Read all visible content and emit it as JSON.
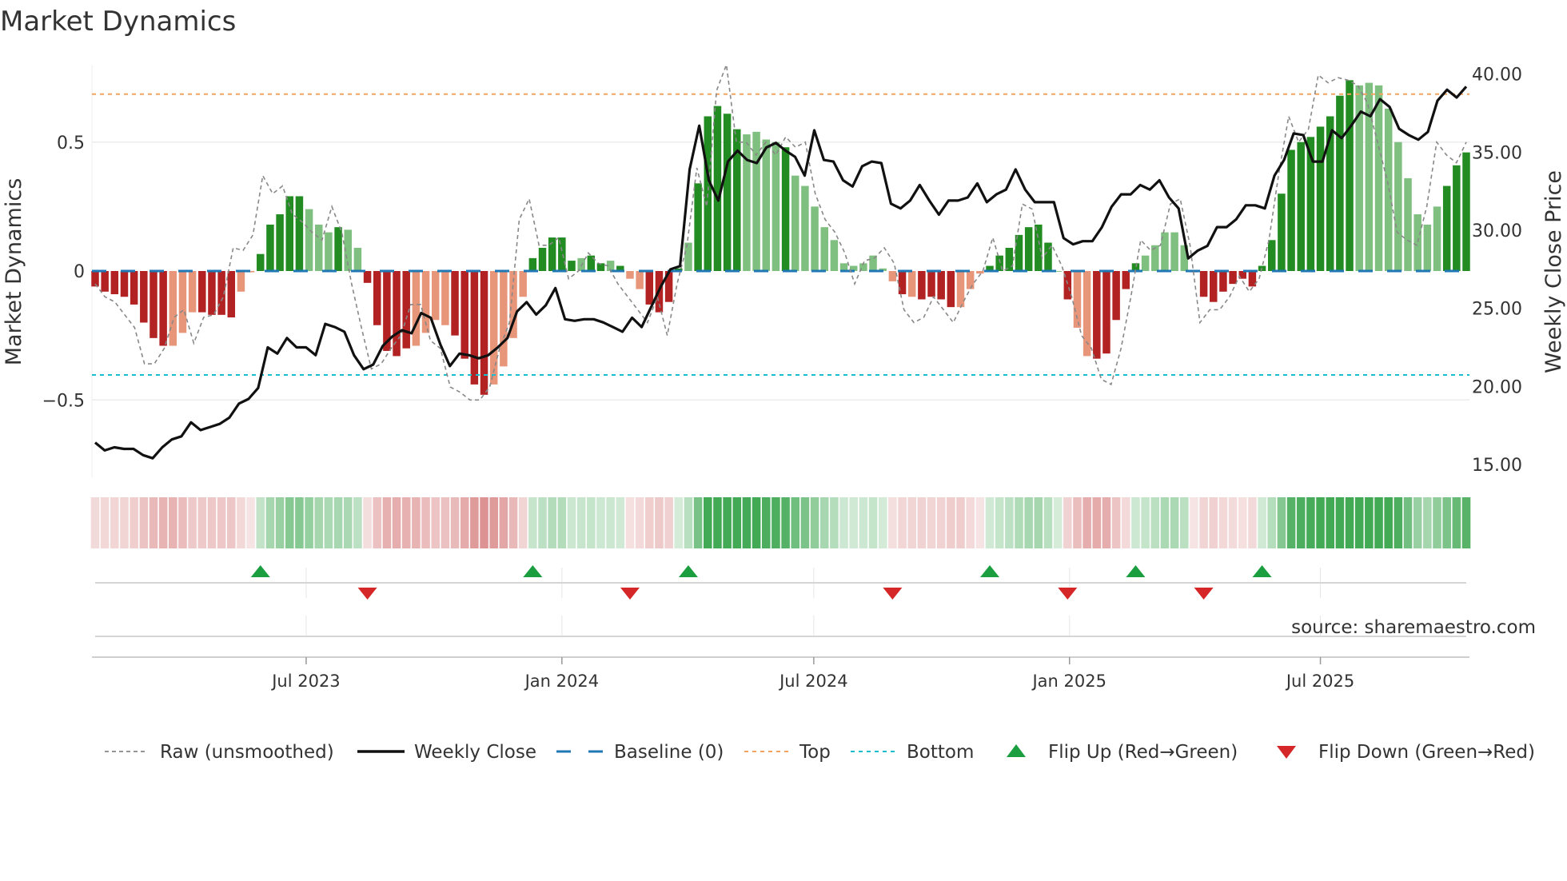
{
  "chart_data": {
    "type": "bar",
    "title": "Market Dynamics",
    "ylabel_left": "Market Dynamics",
    "ylabel_right": "Weekly Close Price",
    "ylim_left": [
      -0.8,
      0.8
    ],
    "ylim_right": [
      14.18,
      40.6
    ],
    "left_ticks": [
      {
        "v": 0.5,
        "label": "0.5"
      },
      {
        "v": 0,
        "label": "0"
      },
      {
        "v": -0.5,
        "label": "−0.5"
      }
    ],
    "right_ticks": [
      {
        "v": 40,
        "label": "40.00"
      },
      {
        "v": 35,
        "label": "35.00"
      },
      {
        "v": 30,
        "label": "30.00"
      },
      {
        "v": 25,
        "label": "25.00"
      },
      {
        "v": 20,
        "label": "20.00"
      },
      {
        "v": 15,
        "label": "15.00"
      }
    ],
    "x_ticks": [
      {
        "week": 21.7,
        "label": "Jul 2023"
      },
      {
        "week": 48.0,
        "label": "Jan 2024"
      },
      {
        "week": 73.9,
        "label": "Jul 2024"
      },
      {
        "week": 100.2,
        "label": "Jan 2025"
      },
      {
        "week": 126.0,
        "label": "Jul 2025"
      }
    ],
    "grid": true,
    "thresholds": {
      "top": 0.686,
      "bottom": -0.403,
      "baseline": 0
    },
    "colors": {
      "strong_down": "#b22222",
      "weak_down": "#e8967a",
      "strong_up": "#228b22",
      "weak_up": "#7fbf7f",
      "raw": "#888888",
      "close": "#111111",
      "baseline": "#1f77b4",
      "top": "#f4a460",
      "bottom": "#17becf",
      "flip_up": "#1a9e3f",
      "flip_down": "#d62728"
    },
    "momentum": [
      -0.06,
      -0.08,
      -0.09,
      -0.1,
      -0.13,
      -0.2,
      -0.26,
      -0.29,
      -0.29,
      -0.24,
      -0.16,
      -0.16,
      -0.17,
      -0.17,
      -0.18,
      -0.08,
      -0.005,
      0.066,
      0.18,
      0.22,
      0.29,
      0.29,
      0.24,
      0.18,
      0.15,
      0.17,
      0.16,
      0.09,
      -0.046,
      -0.21,
      -0.31,
      -0.33,
      -0.3,
      -0.29,
      -0.24,
      -0.19,
      -0.21,
      -0.25,
      -0.34,
      -0.44,
      -0.48,
      -0.44,
      -0.37,
      -0.26,
      -0.1,
      0.05,
      0.09,
      0.13,
      0.13,
      0.04,
      0.05,
      0.06,
      0.03,
      0.04,
      0.02,
      -0.03,
      -0.07,
      -0.13,
      -0.16,
      -0.12,
      0.01,
      0.11,
      0.34,
      0.6,
      0.64,
      0.61,
      0.55,
      0.53,
      0.54,
      0.51,
      0.5,
      0.48,
      0.37,
      0.33,
      0.25,
      0.17,
      0.12,
      0.03,
      0.02,
      0.03,
      0.06,
      0.01,
      -0.04,
      -0.09,
      -0.1,
      -0.11,
      -0.1,
      -0.11,
      -0.14,
      -0.14,
      -0.07,
      -0.01,
      0.02,
      0.06,
      0.09,
      0.14,
      0.17,
      0.18,
      0.11,
      0.0,
      -0.11,
      -0.22,
      -0.33,
      -0.34,
      -0.32,
      -0.19,
      -0.07,
      0.03,
      0.06,
      0.1,
      0.15,
      0.15,
      0.1,
      -0.005,
      -0.1,
      -0.12,
      -0.08,
      -0.05,
      -0.03,
      -0.06,
      0.02,
      0.12,
      0.3,
      0.47,
      0.5,
      0.52,
      0.56,
      0.6,
      0.68,
      0.74,
      0.72,
      0.73,
      0.72,
      0.63,
      0.5,
      0.36,
      0.22,
      0.18,
      0.25,
      0.33,
      0.41,
      0.46
    ],
    "strength": "ddddddddlllddddlldddddllldlldddddllllddddlllldddddlddldllddddldddddlllldllllllllllldlddddllldddddddddlldddddllllldddddddddddddddddllllllllldddddddddddlldldllllllddddd",
    "raw": [
      -0.05,
      -0.1,
      -0.12,
      -0.17,
      -0.22,
      -0.36,
      -0.36,
      -0.3,
      -0.18,
      -0.15,
      -0.28,
      -0.18,
      -0.17,
      -0.1,
      0.09,
      0.08,
      0.14,
      0.37,
      0.3,
      0.33,
      0.22,
      0.19,
      0.15,
      0.12,
      0.25,
      0.15,
      -0.05,
      -0.22,
      -0.38,
      -0.36,
      -0.3,
      -0.25,
      -0.13,
      -0.13,
      -0.27,
      -0.3,
      -0.45,
      -0.47,
      -0.5,
      -0.5,
      -0.45,
      -0.3,
      -0.2,
      0.2,
      0.28,
      0.1,
      0.1,
      0.13,
      -0.03,
      0.0,
      0.07,
      0.03,
      0.02,
      -0.05,
      -0.1,
      -0.15,
      -0.2,
      -0.1,
      -0.25,
      -0.05,
      0.1,
      0.4,
      0.25,
      0.7,
      0.8,
      0.5,
      0.5,
      0.45,
      0.5,
      0.45,
      0.52,
      0.48,
      0.5,
      0.3,
      0.2,
      0.15,
      0.07,
      -0.05,
      0.04,
      0.05,
      0.09,
      0.03,
      -0.15,
      -0.2,
      -0.18,
      -0.1,
      -0.15,
      -0.2,
      -0.12,
      -0.05,
      0.0,
      0.13,
      0.0,
      0.02,
      0.26,
      0.24,
      0.05,
      0.1,
      0.02,
      -0.1,
      -0.25,
      -0.3,
      -0.42,
      -0.44,
      -0.3,
      -0.1,
      0.12,
      0.08,
      0.1,
      0.26,
      0.28,
      0.1,
      -0.2,
      -0.15,
      -0.15,
      -0.1,
      -0.02,
      -0.08,
      -0.03,
      0.12,
      0.38,
      0.6,
      0.5,
      0.55,
      0.76,
      0.73,
      0.75,
      0.74,
      0.72,
      0.65,
      0.5,
      0.35,
      0.15,
      0.12,
      0.1,
      0.25,
      0.5,
      0.45,
      0.42,
      0.5
    ],
    "close": [
      16.4,
      15.9,
      16.1,
      16.0,
      16.0,
      15.6,
      15.4,
      16.1,
      16.6,
      16.8,
      17.7,
      17.2,
      17.4,
      17.6,
      18.0,
      18.9,
      19.2,
      19.9,
      22.5,
      22.1,
      23.1,
      22.5,
      22.5,
      22.0,
      24.0,
      23.8,
      23.5,
      22.0,
      21.1,
      21.4,
      22.6,
      23.2,
      23.6,
      23.4,
      24.7,
      24.4,
      22.7,
      21.3,
      22.1,
      22.0,
      21.8,
      22.0,
      22.5,
      23.1,
      24.8,
      25.4,
      24.6,
      25.2,
      26.3,
      24.3,
      24.2,
      24.3,
      24.3,
      24.1,
      23.8,
      23.5,
      24.4,
      23.8,
      25.1,
      26.4,
      27.5,
      27.7,
      33.9,
      36.7,
      33.2,
      31.9,
      34.4,
      35.1,
      34.5,
      34.3,
      35.3,
      35.6,
      35.1,
      34.7,
      33.5,
      36.4,
      34.5,
      34.4,
      33.2,
      32.8,
      34.1,
      34.4,
      34.3,
      31.7,
      31.4,
      31.9,
      32.9,
      31.9,
      31.0,
      31.9,
      31.9,
      32.1,
      33.0,
      31.8,
      32.3,
      32.6,
      33.9,
      32.6,
      31.8,
      31.8,
      31.8,
      29.5,
      29.1,
      29.3,
      29.3,
      30.2,
      31.5,
      32.3,
      32.3,
      32.9,
      32.6,
      33.2,
      32.1,
      31.4,
      28.2,
      28.7,
      29.0,
      30.2,
      30.2,
      30.7,
      31.6,
      31.6,
      31.4,
      33.5,
      34.5,
      36.2,
      36.1,
      34.4,
      34.4,
      36.4,
      35.9,
      36.7,
      37.6,
      37.3,
      38.4,
      37.9,
      36.5,
      36.1,
      35.8,
      36.3,
      38.3,
      39.0,
      38.5,
      39.2
    ],
    "flip_up_weeks": [
      17,
      45,
      61,
      92,
      107,
      120
    ],
    "flip_down_weeks": [
      28,
      55,
      82,
      100,
      114
    ],
    "legend": {
      "placement": "bottom",
      "items": [
        {
          "key": "raw",
          "label": "Raw (unsmoothed)"
        },
        {
          "key": "close",
          "label": "Weekly Close"
        },
        {
          "key": "baseline",
          "label": "Baseline (0)"
        },
        {
          "key": "top",
          "label": "Top"
        },
        {
          "key": "bottom",
          "label": "Bottom"
        },
        {
          "key": "flip_up",
          "label": "Flip Up (Red→Green)"
        },
        {
          "key": "flip_down",
          "label": "Flip Down (Green→Red)"
        }
      ]
    },
    "source": "source: sharemaestro.com"
  }
}
